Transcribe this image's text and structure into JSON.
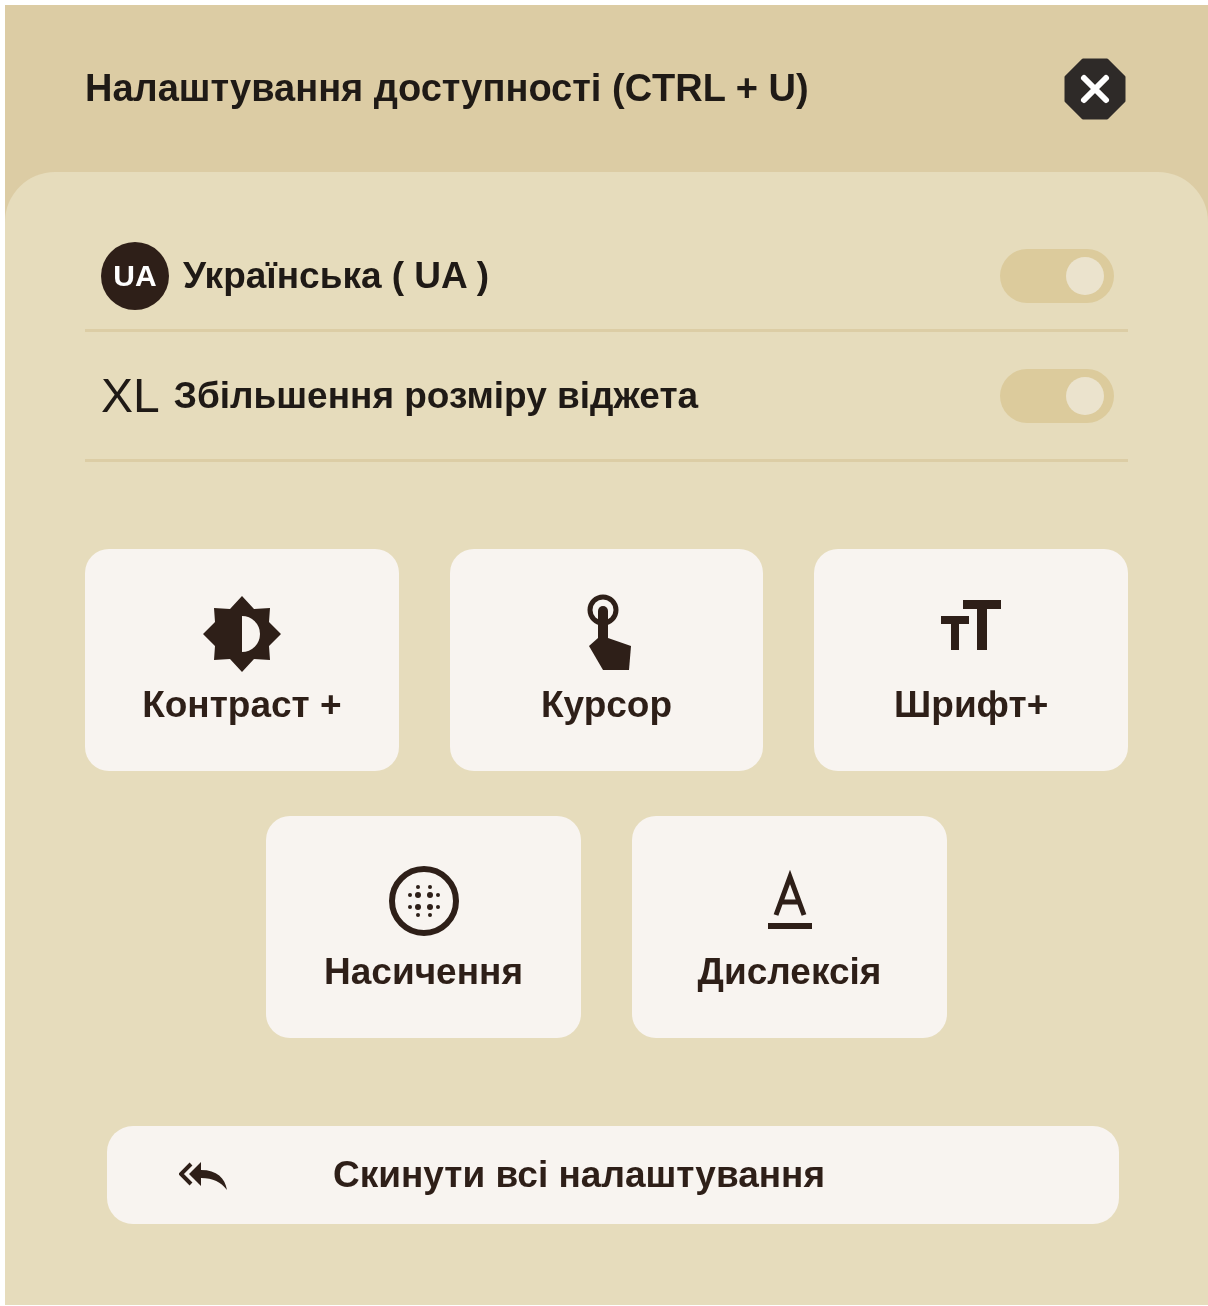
{
  "title": "Налаштування доступності (CTRL + U)",
  "toggles": [
    {
      "kind": "badge",
      "badge": "UA",
      "label": "Українська ( UA )",
      "on": false
    },
    {
      "kind": "text",
      "badge": "XL",
      "label": "Збільшення розміру віджета",
      "on": false
    }
  ],
  "tiles": [
    {
      "kind": "contrast",
      "label": "Контраст +"
    },
    {
      "kind": "cursor",
      "label": "Курсор"
    },
    {
      "kind": "font",
      "label": "Шрифт+"
    },
    {
      "kind": "saturation",
      "label": "Насичення"
    },
    {
      "kind": "dyslexia",
      "label": "Дислексія"
    }
  ],
  "reset": {
    "label": "Скинути всі налаштування"
  }
}
